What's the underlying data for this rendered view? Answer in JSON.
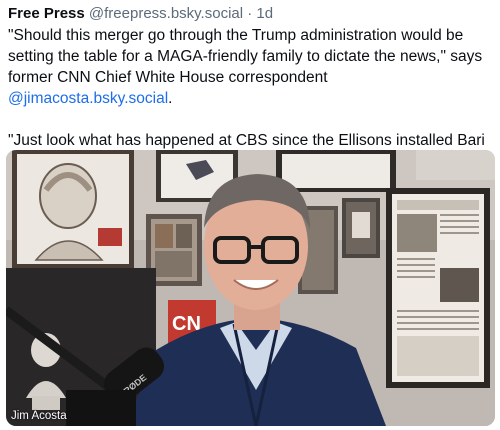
{
  "post": {
    "author_name": "Free Press",
    "handle": "@freepress.bsky.social",
    "separator": "·",
    "time": "1d",
    "paragraph1_text": "\"Should this merger go through the Trump administration would be setting the table for a MAGA-friendly family to dictate the news,\" says former CNN Chief White House correspondent ",
    "paragraph1_mention": "@jimacosta.bsky.social",
    "paragraph1_end": ".",
    "paragraph2": "\"Just look what has happened at CBS since the Ellisons installed Bari Weiss.\""
  },
  "video": {
    "name_tag": "Jim Acosta",
    "mug_text": "CN",
    "mic_text": "RØDE"
  },
  "colors": {
    "mention": "#1d6ee8",
    "muted": "#5c6b7a",
    "text": "#0b0f14"
  }
}
